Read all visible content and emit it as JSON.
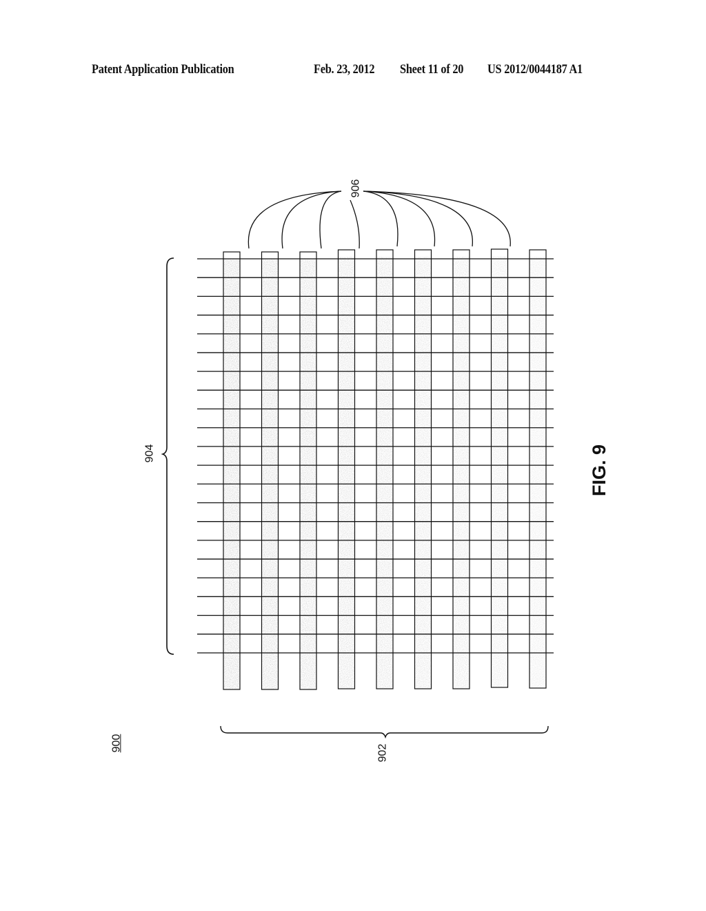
{
  "header": {
    "publication": "Patent Application Publication",
    "date": "Feb. 23, 2012",
    "sheet": "Sheet 11 of 20",
    "number": "US 2012/0044187 A1"
  },
  "figure": {
    "label": "FIG. 9",
    "ref_main": "900",
    "ref_columns": "902",
    "ref_rows": "904",
    "ref_column_items": "906",
    "column_count": 9,
    "row_line_count": 22,
    "column_fill_color": "#d6d6d6",
    "line_color": "#111111"
  }
}
